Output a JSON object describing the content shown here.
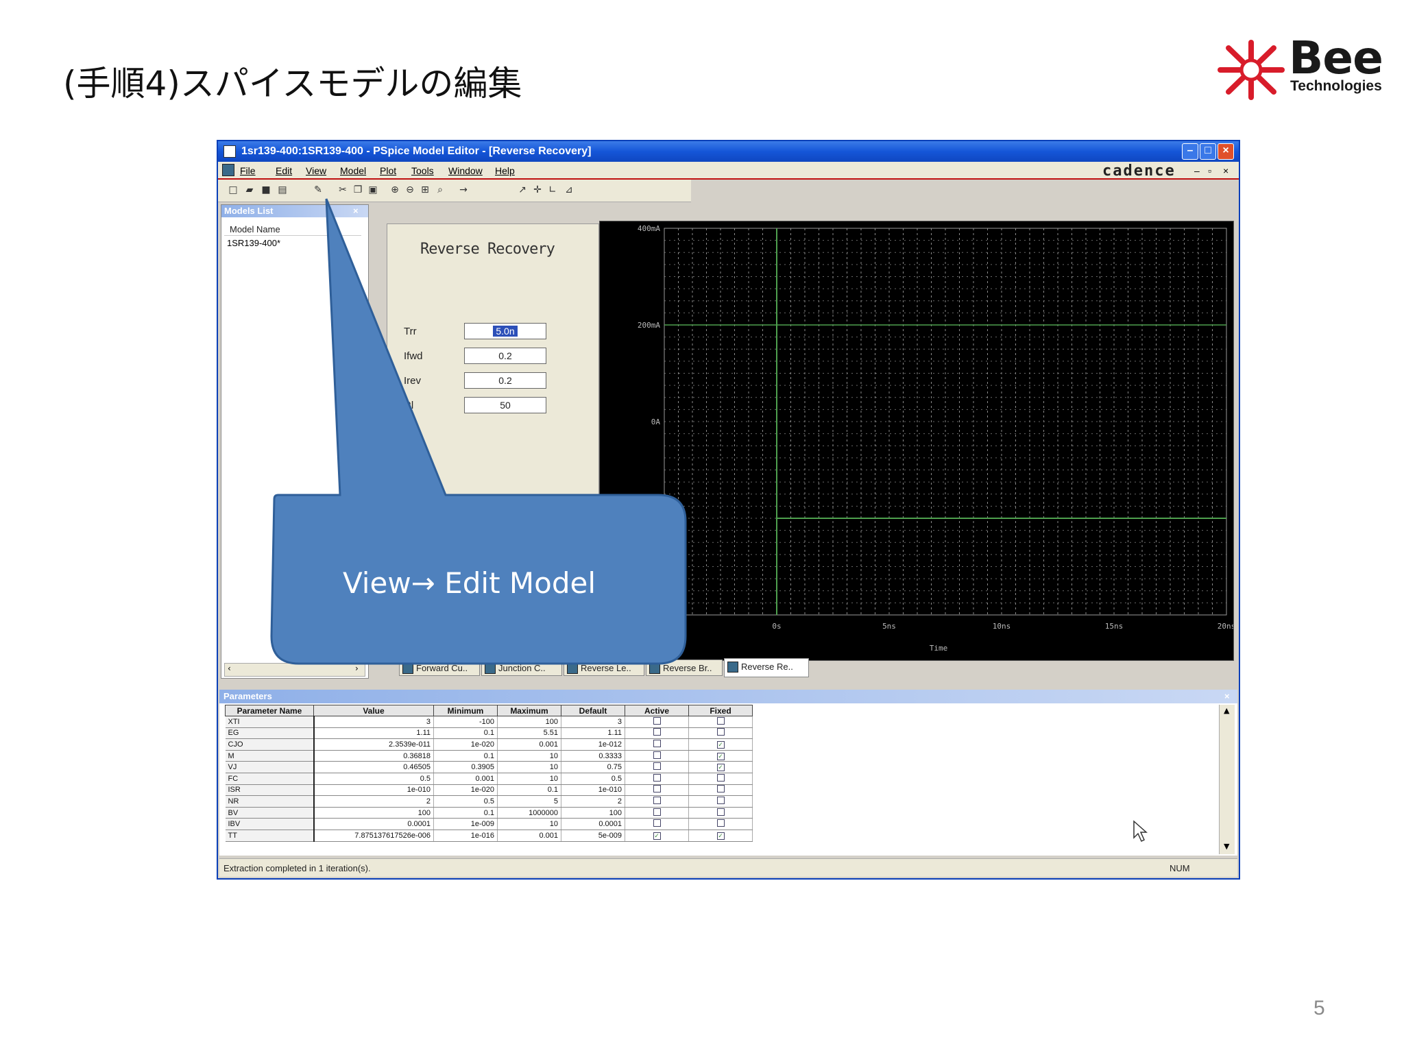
{
  "slide": {
    "title": "(手順4)スパイスモデルの編集",
    "page_number": "5",
    "logo": {
      "brand": "Bee",
      "sub": "Technologies"
    }
  },
  "window": {
    "title": "1sr139-400:1SR139-400 - PSpice Model Editor - [Reverse Recovery]",
    "menu": [
      "File",
      "Edit",
      "View",
      "Model",
      "Plot",
      "Tools",
      "Window",
      "Help"
    ],
    "brand": "cadence"
  },
  "models_list": {
    "header": "Models List",
    "columns": [
      "Model Name"
    ],
    "rows": [
      "1SR139-400*"
    ]
  },
  "reverse_recovery": {
    "title": "Reverse Recovery",
    "fields": [
      {
        "label": "Trr",
        "value": "5.0n"
      },
      {
        "label": "Ifwd",
        "value": "0.2"
      },
      {
        "label": "Irev",
        "value": "0.2"
      },
      {
        "label": "Rl",
        "value": "50"
      }
    ]
  },
  "chart_data": {
    "type": "line",
    "yticks": [
      "400mA",
      "200mA",
      "0A"
    ],
    "xticks": [
      "0s",
      "5ns",
      "10ns",
      "15ns",
      "20ns"
    ],
    "xlabel": "Time",
    "ylim": [
      -400,
      400
    ],
    "xlim": [
      -5,
      20
    ],
    "series_color": "#4ea04e"
  },
  "tabs": [
    "Forward Cu..",
    "Junction C..",
    "Reverse Le..",
    "Reverse Br..",
    "Reverse Re.."
  ],
  "parameters": {
    "header": "Parameters",
    "columns": [
      "Parameter Name",
      "Value",
      "Minimum",
      "Maximum",
      "Default",
      "Active",
      "Fixed"
    ],
    "rows": [
      {
        "name": "XTI",
        "value": "3",
        "min": "-100",
        "max": "100",
        "default": "3",
        "active": false,
        "fixed": false
      },
      {
        "name": "EG",
        "value": "1.11",
        "min": "0.1",
        "max": "5.51",
        "default": "1.11",
        "active": false,
        "fixed": false
      },
      {
        "name": "CJO",
        "value": "2.3539e-011",
        "min": "1e-020",
        "max": "0.001",
        "default": "1e-012",
        "active": false,
        "fixed": true
      },
      {
        "name": "M",
        "value": "0.36818",
        "min": "0.1",
        "max": "10",
        "default": "0.3333",
        "active": false,
        "fixed": true
      },
      {
        "name": "VJ",
        "value": "0.46505",
        "min": "0.3905",
        "max": "10",
        "default": "0.75",
        "active": false,
        "fixed": true
      },
      {
        "name": "FC",
        "value": "0.5",
        "min": "0.001",
        "max": "10",
        "default": "0.5",
        "active": false,
        "fixed": false
      },
      {
        "name": "ISR",
        "value": "1e-010",
        "min": "1e-020",
        "max": "0.1",
        "default": "1e-010",
        "active": false,
        "fixed": false
      },
      {
        "name": "NR",
        "value": "2",
        "min": "0.5",
        "max": "5",
        "default": "2",
        "active": false,
        "fixed": false
      },
      {
        "name": "BV",
        "value": "100",
        "min": "0.1",
        "max": "1000000",
        "default": "100",
        "active": false,
        "fixed": false
      },
      {
        "name": "IBV",
        "value": "0.0001",
        "min": "1e-009",
        "max": "10",
        "default": "0.0001",
        "active": false,
        "fixed": false
      },
      {
        "name": "TT",
        "value": "7.875137617526e-006",
        "min": "1e-016",
        "max": "0.001",
        "default": "5e-009",
        "active": true,
        "fixed": true
      }
    ]
  },
  "status": {
    "text": "Extraction completed in 1 iteration(s).",
    "num": "NUM"
  },
  "callout": {
    "text": "View→ Edit Model",
    "fill": "#4f81bd"
  }
}
